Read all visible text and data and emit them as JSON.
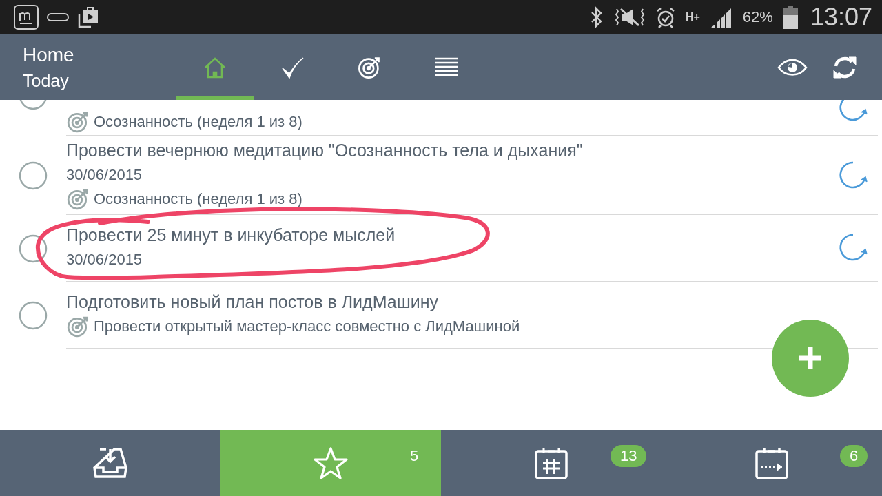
{
  "status_bar": {
    "network": "H+",
    "battery": "62%",
    "time": "13:07"
  },
  "header": {
    "title": "Home",
    "subtitle": "Today",
    "tabs": [
      {
        "kind": "home",
        "selected": true
      },
      {
        "kind": "check",
        "selected": false
      },
      {
        "kind": "target",
        "selected": false
      },
      {
        "kind": "list",
        "selected": false
      }
    ]
  },
  "tasks": [
    {
      "goal": "Осознанность (неделя 1 из 8)",
      "checked": false,
      "repeat": true,
      "circled": false
    },
    {
      "title": "Провести вечернюю медитацию \"Осознанность тела и дыхания\"",
      "date": "30/06/2015",
      "goal": "Осознанность (неделя 1 из 8)",
      "checked": false,
      "repeat": true,
      "circled": false
    },
    {
      "title": "Провести 25 минут в инкубаторе мыслей",
      "date": "30/06/2015",
      "checked": false,
      "repeat": true,
      "circled": true
    },
    {
      "title": "Подготовить новый план постов в ЛидМашину",
      "goal": "Провести открытый мастер-класс совместно с ЛидМашиной",
      "checked": false,
      "repeat": false,
      "circled": false
    }
  ],
  "bottom_nav": [
    {
      "kind": "inbox",
      "selected": false
    },
    {
      "kind": "star",
      "selected": true,
      "count": "5"
    },
    {
      "kind": "calendar",
      "selected": false,
      "count": "13"
    },
    {
      "kind": "calendar-next",
      "selected": false,
      "count": "6"
    }
  ]
}
